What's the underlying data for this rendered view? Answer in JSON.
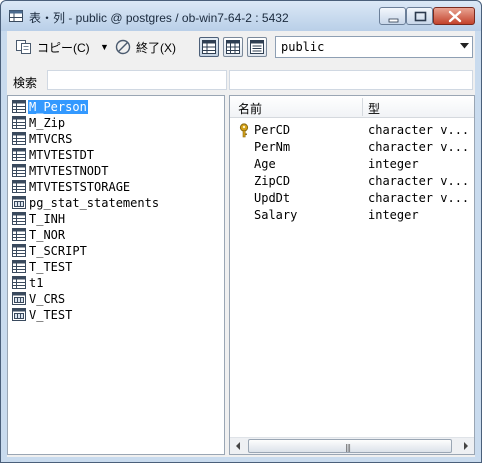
{
  "window": {
    "title": "表・列 - public @ postgres / ob-win7-64-2 : 5432",
    "icons": {
      "app": "table-icon",
      "minimize": "minimize-icon",
      "maximize": "maximize-icon",
      "close": "close-icon"
    }
  },
  "toolbar": {
    "copy_label": "コピー(C)",
    "copy_icon": "copy-icon",
    "dropdown_arrow": "▼",
    "exit_label": "終了(X)",
    "exit_icon": "stop-icon",
    "view_buttons": [
      "table-view-icon",
      "grid-view-icon",
      "list-view-icon"
    ],
    "schema_value": "public"
  },
  "search": {
    "label": "検索",
    "value": "",
    "filter_value": ""
  },
  "tables": [
    {
      "name": "M_Person",
      "selected": true,
      "icon": "table-icon"
    },
    {
      "name": "M_Zip",
      "selected": false,
      "icon": "table-icon"
    },
    {
      "name": "MTVCRS",
      "selected": false,
      "icon": "table-icon"
    },
    {
      "name": "MTVTESTDT",
      "selected": false,
      "icon": "table-icon"
    },
    {
      "name": "MTVTESTNODT",
      "selected": false,
      "icon": "table-icon"
    },
    {
      "name": "MTVTESTSTORAGE",
      "selected": false,
      "icon": "table-icon"
    },
    {
      "name": "pg_stat_statements",
      "selected": false,
      "icon": "view-icon"
    },
    {
      "name": "T_INH",
      "selected": false,
      "icon": "table-icon"
    },
    {
      "name": "T_NOR",
      "selected": false,
      "icon": "table-icon"
    },
    {
      "name": "T_SCRIPT",
      "selected": false,
      "icon": "table-icon"
    },
    {
      "name": "T_TEST",
      "selected": false,
      "icon": "table-icon"
    },
    {
      "name": "t1",
      "selected": false,
      "icon": "table-icon"
    },
    {
      "name": "V_CRS",
      "selected": false,
      "icon": "view-icon"
    },
    {
      "name": "V_TEST",
      "selected": false,
      "icon": "view-icon"
    }
  ],
  "columns_panel": {
    "header_name": "名前",
    "header_type": "型",
    "rows": [
      {
        "name": "PerCD",
        "type": "character v...",
        "key": true
      },
      {
        "name": "PerNm",
        "type": "character v...",
        "key": false
      },
      {
        "name": "Age",
        "type": "integer",
        "key": false
      },
      {
        "name": "ZipCD",
        "type": "character v...",
        "key": false
      },
      {
        "name": "UpdDt",
        "type": "character v...",
        "key": false
      },
      {
        "name": "Salary",
        "type": "integer",
        "key": false
      }
    ],
    "scrollbar_grip": "|||"
  },
  "colors": {
    "selection": "#3399ff",
    "titlebar": "#c9dbee",
    "close_button": "#c3432c",
    "key_icon": "#d4a017"
  }
}
